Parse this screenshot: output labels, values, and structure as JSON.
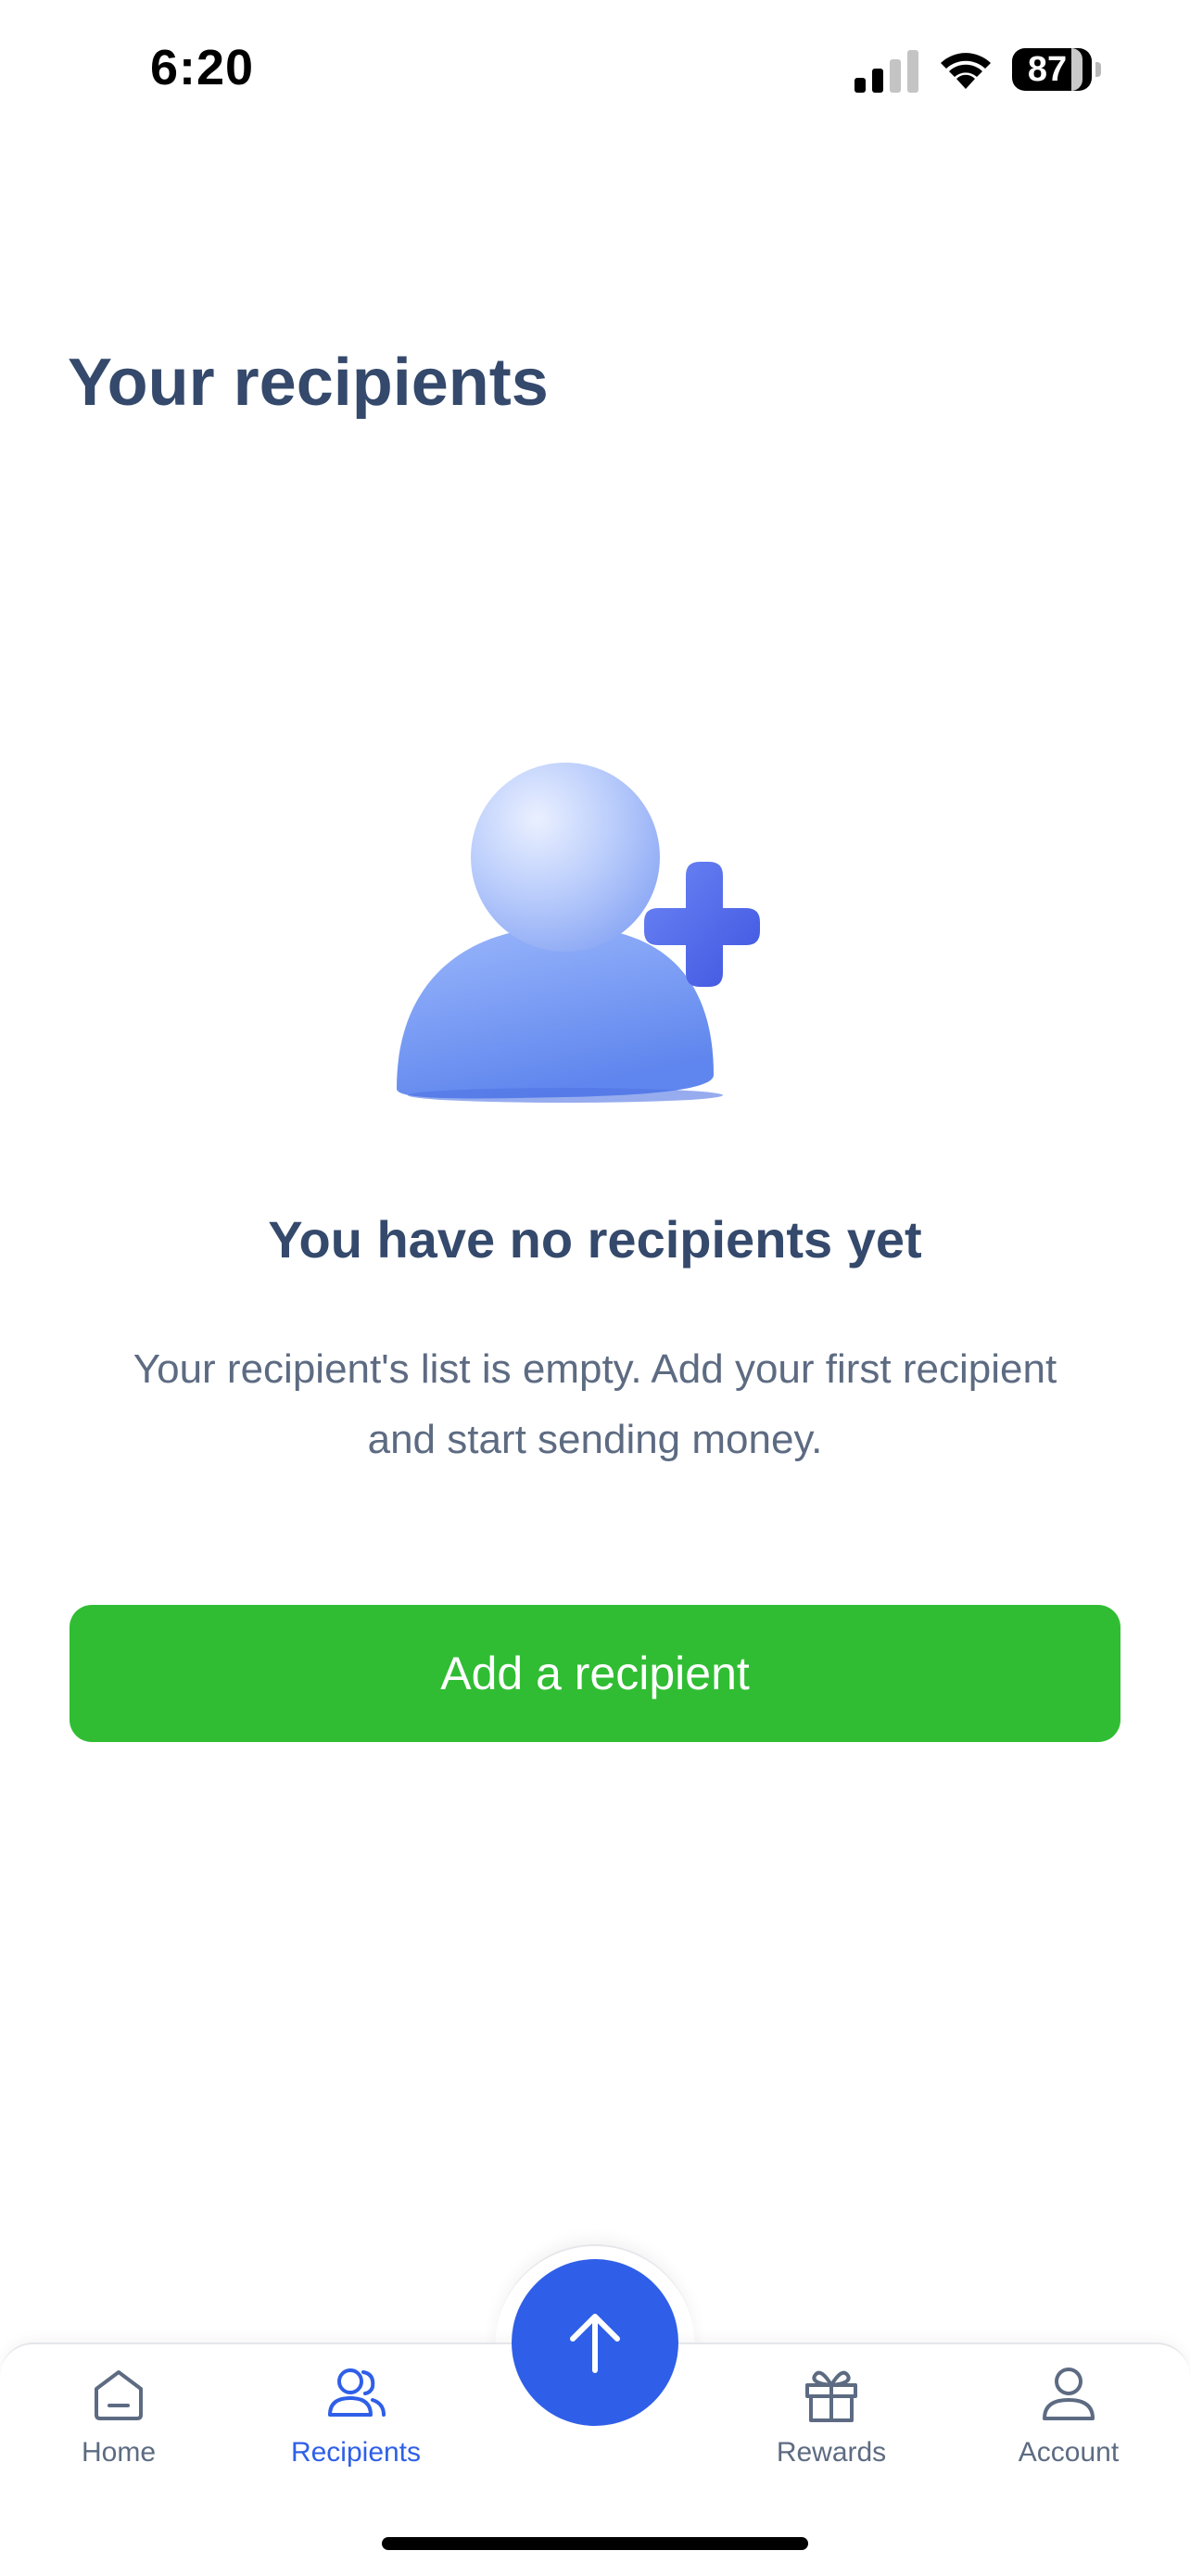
{
  "status_bar": {
    "time": "6:20",
    "battery": "87"
  },
  "page": {
    "title": "Your recipients"
  },
  "empty_state": {
    "illustration": "add-person-icon",
    "title": "You have no recipients yet",
    "description": "Your recipient's list is empty. Add your first recipient and start sending money.",
    "button_label": "Add a recipient"
  },
  "tab_bar": {
    "active": "Recipients",
    "items": [
      {
        "label": "Home",
        "icon": "home-icon"
      },
      {
        "label": "Recipients",
        "icon": "users-icon"
      },
      {
        "label": "Rewards",
        "icon": "gift-icon"
      },
      {
        "label": "Account",
        "icon": "user-icon"
      }
    ],
    "fab_icon": "arrow-up-icon"
  },
  "colors": {
    "primary_blue": "#2f5fe8",
    "button_green": "#30bd33",
    "heading": "#34496b",
    "body_text": "#5d6b82"
  }
}
